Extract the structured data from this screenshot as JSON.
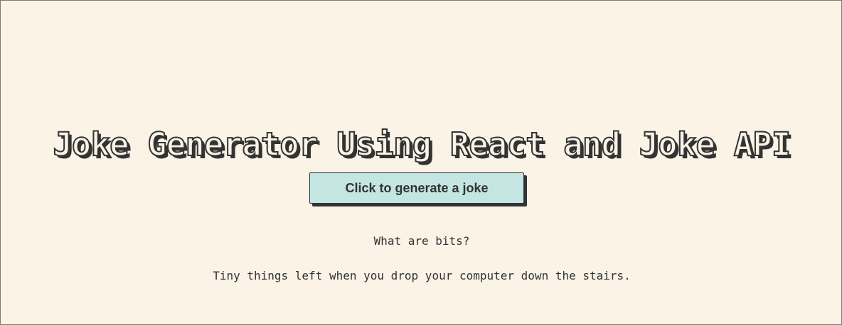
{
  "page": {
    "title": "Joke Generator Using React and Joke API"
  },
  "actions": {
    "generate_label": "Click to generate a joke"
  },
  "joke": {
    "setup": "What are bits?",
    "punchline": "Tiny things left when you drop your computer down the stairs."
  },
  "colors": {
    "background": "#faf3e6",
    "button": "#c3e6e3",
    "text": "#333333"
  }
}
